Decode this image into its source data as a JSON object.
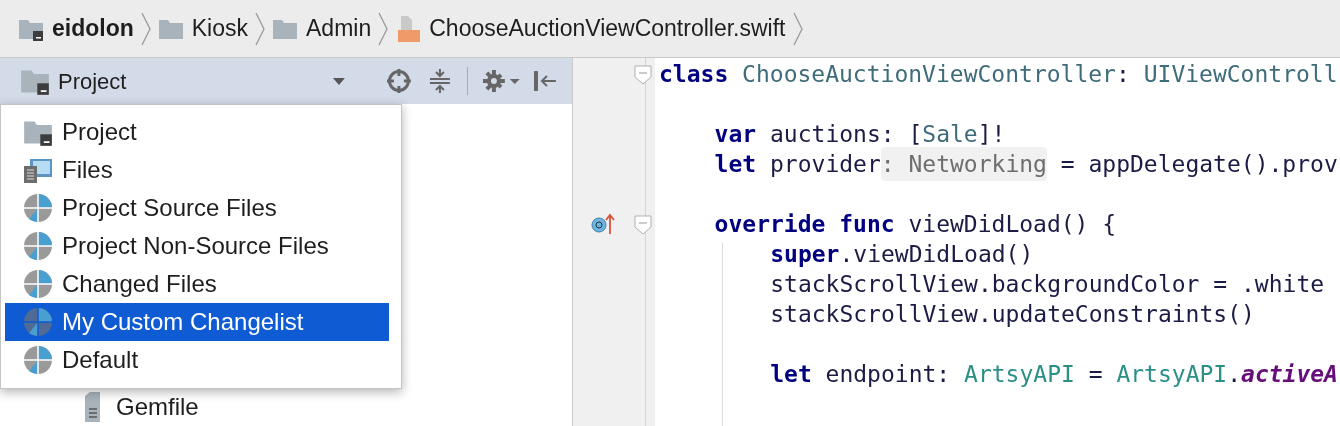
{
  "breadcrumbs": [
    {
      "label": "eidolon",
      "kind": "module"
    },
    {
      "label": "Kiosk",
      "kind": "folder"
    },
    {
      "label": "Admin",
      "kind": "folder"
    },
    {
      "label": "ChooseAuctionViewController.swift",
      "kind": "swift"
    }
  ],
  "panel_header": {
    "title": "Project"
  },
  "view_menu": [
    {
      "label": "Project",
      "kind": "project",
      "selected": false
    },
    {
      "label": "Files",
      "kind": "files",
      "selected": false
    },
    {
      "label": "Project Source Files",
      "kind": "scope",
      "selected": false
    },
    {
      "label": "Project Non-Source Files",
      "kind": "scope",
      "selected": false
    },
    {
      "label": "Changed Files",
      "kind": "scope",
      "selected": false
    },
    {
      "label": "My Custom Changelist",
      "kind": "scope",
      "selected": true
    },
    {
      "label": "Default",
      "kind": "scope",
      "selected": false
    }
  ],
  "tree": [
    {
      "label": "Gemfile"
    }
  ],
  "code_lines": [
    {
      "kind": "code",
      "fold": true,
      "override_marker": false,
      "segments": [
        {
          "kind": "keyword",
          "text": "class"
        },
        {
          "kind": "type",
          "text": " ChooseAuctionViewController"
        },
        {
          "kind": "plain",
          "text": ": "
        },
        {
          "kind": "type",
          "text": "UIViewControll"
        }
      ],
      "children": [
        {
          "kind": "blank"
        },
        {
          "kind": "code",
          "fold": false,
          "override_marker": false,
          "segments": [
            {
              "kind": "keyword",
              "text": "var"
            },
            {
              "kind": "plain",
              "text": " auctions: ["
            },
            {
              "kind": "type",
              "text": "Sale"
            },
            {
              "kind": "plain",
              "text": "]!"
            }
          ]
        },
        {
          "kind": "code",
          "fold": false,
          "override_marker": false,
          "segments": [
            {
              "kind": "keyword",
              "text": "let"
            },
            {
              "kind": "plain",
              "text": " provider"
            },
            {
              "kind": "hint",
              "text": ": Networking"
            },
            {
              "kind": "plain",
              "text": " = appDelegate().prov"
            }
          ]
        },
        {
          "kind": "blank"
        },
        {
          "kind": "code",
          "fold": true,
          "override_marker": true,
          "segments": [
            {
              "kind": "keyword",
              "text": "override func"
            },
            {
              "kind": "plain",
              "text": " viewDidLoad() {"
            }
          ],
          "children": [
            {
              "kind": "code",
              "fold": false,
              "override_marker": false,
              "segments": [
                {
                  "kind": "keyword",
                  "text": "super"
                },
                {
                  "kind": "plain",
                  "text": ".viewDidLoad()"
                }
              ]
            },
            {
              "kind": "code",
              "fold": false,
              "override_marker": false,
              "segments": [
                {
                  "kind": "plain",
                  "text": "stackScrollView.backgroundColor = .white"
                }
              ]
            },
            {
              "kind": "code",
              "fold": false,
              "override_marker": false,
              "segments": [
                {
                  "kind": "plain",
                  "text": "stackScrollView.updateConstraints()"
                }
              ]
            },
            {
              "kind": "blank"
            },
            {
              "kind": "code",
              "fold": false,
              "override_marker": false,
              "segments": [
                {
                  "kind": "keyword",
                  "text": "let"
                },
                {
                  "kind": "plain",
                  "text": " endpoint: "
                },
                {
                  "kind": "teal",
                  "text": "ArtsyAPI"
                },
                {
                  "kind": "plain",
                  "text": " = "
                },
                {
                  "kind": "teal",
                  "text": "ArtsyAPI"
                },
                {
                  "kind": "plain",
                  "text": "."
                },
                {
                  "kind": "member",
                  "text": "activeA"
                }
              ]
            }
          ]
        }
      ]
    }
  ]
}
